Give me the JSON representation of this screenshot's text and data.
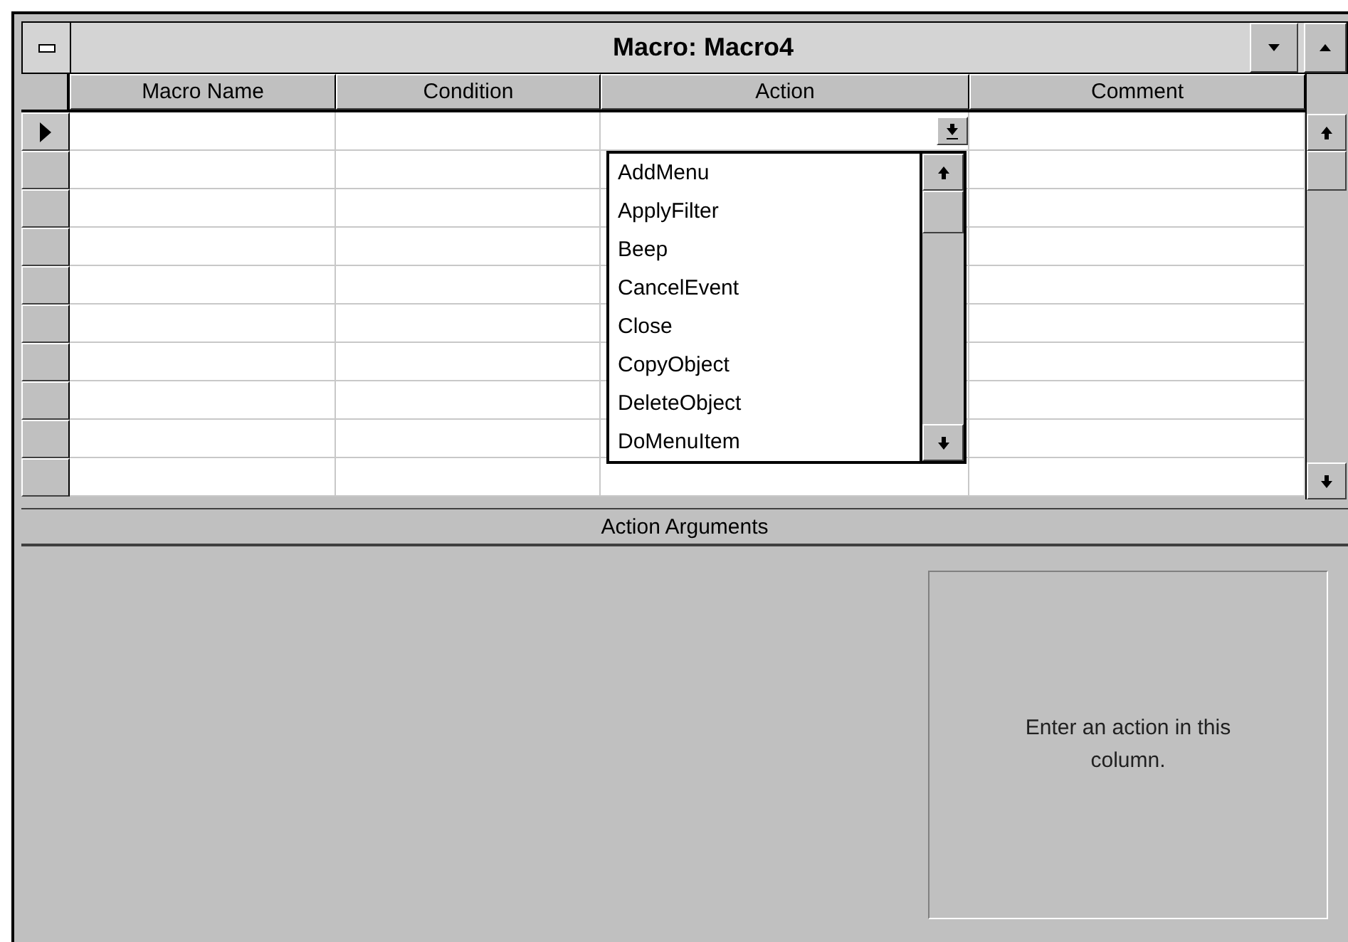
{
  "window": {
    "title": "Macro: Macro4"
  },
  "table": {
    "columns": [
      "Macro Name",
      "Condition",
      "Action",
      "Comment"
    ],
    "rows": [
      {
        "selected": true
      },
      {
        "selected": false
      },
      {
        "selected": false
      },
      {
        "selected": false
      },
      {
        "selected": false
      },
      {
        "selected": false
      },
      {
        "selected": false
      },
      {
        "selected": false
      },
      {
        "selected": false
      },
      {
        "selected": false
      }
    ]
  },
  "action_dropdown": {
    "items": [
      "AddMenu",
      "ApplyFilter",
      "Beep",
      "CancelEvent",
      "Close",
      "CopyObject",
      "DeleteObject",
      "DoMenuItem"
    ]
  },
  "arguments": {
    "title": "Action Arguments",
    "hint": "Enter an action in this column."
  }
}
